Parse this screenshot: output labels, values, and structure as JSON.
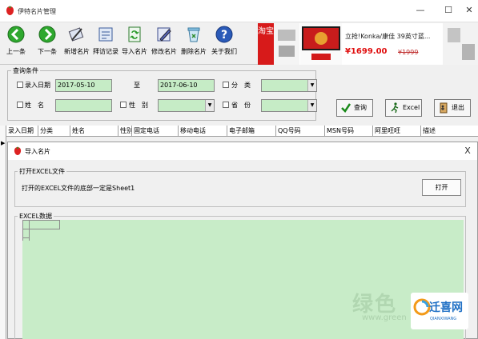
{
  "app": {
    "title": "伊特名片管理"
  },
  "window_controls": {
    "minimize": "—",
    "maximize": "☐",
    "close": "✕"
  },
  "toolbar": {
    "buttons": [
      {
        "label": "上一条",
        "icon": "prev-arrow-icon"
      },
      {
        "label": "下一条",
        "icon": "next-arrow-icon"
      },
      {
        "label": "新增名片",
        "icon": "new-card-icon"
      },
      {
        "label": "拜访记录",
        "icon": "visit-log-icon"
      },
      {
        "label": "导入名片",
        "icon": "import-card-icon"
      },
      {
        "label": "修改名片",
        "icon": "edit-card-icon"
      },
      {
        "label": "删除名片",
        "icon": "delete-card-icon"
      },
      {
        "label": "关于我们",
        "icon": "help-icon"
      }
    ]
  },
  "ad": {
    "brand": "淘宝",
    "title": "立抢!Konka/康佳 39英寸蓝...",
    "price": "¥1699.00",
    "old_price": "¥1999"
  },
  "query": {
    "legend": "查询条件",
    "date_label": "录入日期",
    "date_from": "2017-05-10",
    "to_label": "至",
    "date_to": "2017-06-10",
    "category_label": "分　类",
    "name_label": "姓　名",
    "gender_label": "性　别",
    "province_label": "省　份"
  },
  "actions": {
    "search": "查询",
    "excel": "Excel",
    "exit": "退出"
  },
  "grid": {
    "columns": [
      "录入日期",
      "分类",
      "姓名",
      "性别",
      "固定电话",
      "移动电话",
      "电子邮箱",
      "QQ号码",
      "MSN号码",
      "阿里旺旺",
      "描述"
    ]
  },
  "dialog": {
    "title": "导入名片",
    "close": "X",
    "open_group": "打开EXCEL文件",
    "note": "打开的EXCEL文件的底部一定是Sheet1",
    "open_button": "打开",
    "data_group": "EXCEL数据"
  },
  "watermark": {
    "site_text": "绿色",
    "url": "www.green",
    "logo": "迁喜网",
    "logo_sub": "QIANXIWANG"
  }
}
